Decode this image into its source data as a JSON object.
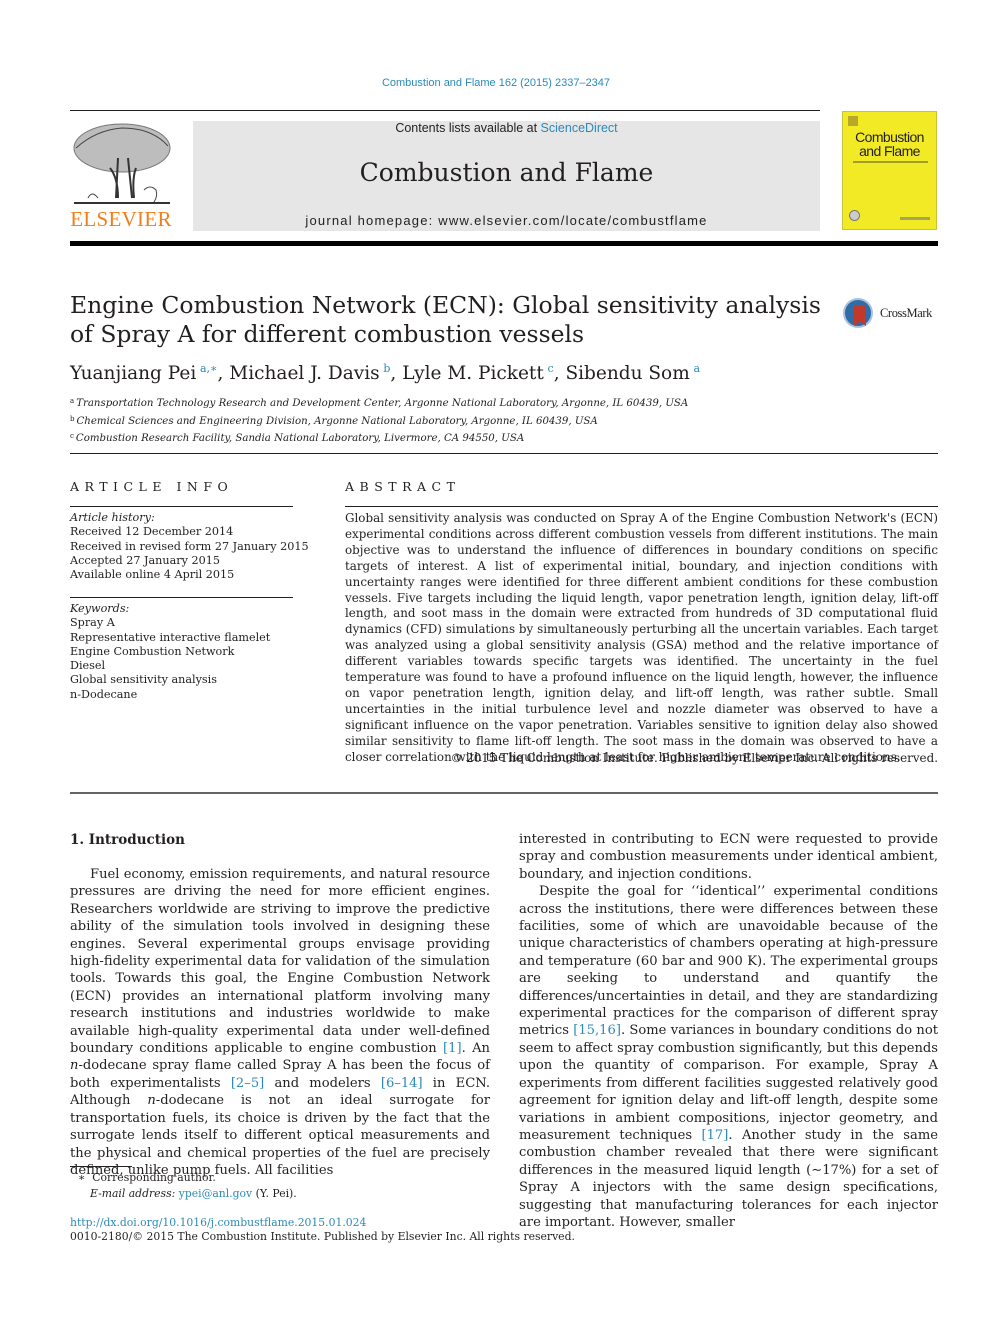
{
  "header": {
    "journal_ref": "Combustion and Flame 162 (2015) 2337–2347",
    "contents_prefix": "Contents lists available at ",
    "contents_link": "ScienceDirect",
    "journal_name": "Combustion and Flame",
    "homepage": "journal homepage: www.elsevier.com/locate/combustflame",
    "publisher_logo_text": "ELSEVIER",
    "cover_title_line1": "Combustion",
    "cover_title_line2": "and Flame",
    "crossmark_label": "CrossMark",
    "colors": {
      "link": "#2b8ab8",
      "elsevier_orange": "#f27e1b",
      "cover_yellow": "#f1ea25",
      "banner_gray": "#e6e6e6"
    }
  },
  "article": {
    "title": "Engine Combustion Network (ECN): Global sensitivity analysis of Spray A for different combustion vessels",
    "authors": [
      {
        "name": "Yuanjiang Pei",
        "sup": "a,∗"
      },
      {
        "name": "Michael J. Davis",
        "sup": "b"
      },
      {
        "name": "Lyle M. Pickett",
        "sup": "c"
      },
      {
        "name": "Sibendu Som",
        "sup": "a"
      }
    ],
    "affiliations": [
      {
        "key": "a",
        "text": "Transportation Technology Research and Development Center, Argonne National Laboratory, Argonne, IL 60439, USA"
      },
      {
        "key": "b",
        "text": "Chemical Sciences and Engineering Division, Argonne National Laboratory, Argonne, IL 60439, USA"
      },
      {
        "key": "c",
        "text": "Combustion Research Facility, Sandia National Laboratory, Livermore, CA 94550, USA"
      }
    ]
  },
  "article_info": {
    "label": "ARTICLE INFO",
    "history_label": "Article history:",
    "history": [
      "Received 12 December 2014",
      "Received in revised form 27 January 2015",
      "Accepted 27 January 2015",
      "Available online 4 April 2015"
    ],
    "keywords_label": "Keywords:",
    "keywords": [
      "Spray A",
      "Representative interactive flamelet",
      "Engine Combustion Network",
      "Diesel",
      "Global sensitivity analysis",
      "n-Dodecane"
    ]
  },
  "abstract": {
    "label": "ABSTRACT",
    "text": "Global sensitivity analysis was conducted on Spray A of the Engine Combustion Network's (ECN) experimental conditions across different combustion vessels from different institutions. The main objective was to understand the influence of differences in boundary conditions on specific targets of interest. A list of experimental initial, boundary, and injection conditions with uncertainty ranges were identified for three different ambient conditions for these combustion vessels. Five targets including the liquid length, vapor penetration length, ignition delay, lift-off length, and soot mass in the domain were extracted from hundreds of 3D computational fluid dynamics (CFD) simulations by simultaneously perturbing all the uncertain variables. Each target was analyzed using a global sensitivity analysis (GSA) method and the relative importance of different variables towards specific targets was identified. The uncertainty in the fuel temperature was found to have a profound influence on the liquid length, however, the influence on vapor penetration length, ignition delay, and lift-off length, was rather subtle. Small uncertainties in the initial turbulence level and nozzle diameter was observed to have a significant influence on the vapor penetration. Variables sensitive to ignition delay also showed similar sensitivity to flame lift-off length. The soot mass in the domain was observed to have a closer correlation with the liquid length at least for higher ambient temperature conditions.",
    "copyright": "© 2015 The Combustion Institute. Published by Elsevier Inc. All rights reserved."
  },
  "body": {
    "section_heading": "1. Introduction",
    "left_column": {
      "p1_a": "Fuel economy, emission requirements, and natural resource pressures are driving the need for more efficient engines. Researchers worldwide are striving to improve the predictive ability of the simulation tools involved in designing these engines. Several experimental groups envisage providing high-fidelity experimental data for validation of the simulation tools. Towards this goal, the Engine Combustion Network (ECN) provides an international platform involving many research institutions and industries worldwide to make available high-quality experimental data under well-defined boundary conditions applicable to engine combustion ",
      "ref1": "[1]",
      "p1_b": ". An ",
      "p1_ital": "n",
      "p1_c": "-dodecane spray flame called Spray A has been the focus of both experimentalists ",
      "ref2": "[2–5]",
      "p1_d": " and modelers ",
      "ref3": "[6–14]",
      "p1_e": " in ECN. Although ",
      "p1_ital2": "n",
      "p1_f": "-dodecane is not an ideal surrogate for transportation fuels, its choice is driven by the fact that the surrogate lends itself to different optical measurements and the physical and chemical properties of the fuel are precisely defined, unlike pump fuels. All facilities"
    },
    "right_column": {
      "p1_cont": "interested in contributing to ECN were requested to provide spray and combustion measurements under identical ambient, boundary, and injection conditions.",
      "p2_a": "Despite the goal for ‘‘identical’’ experimental conditions across the institutions, there were differences between these facilities, some of which are unavoidable because of the unique characteristics of chambers operating at high-pressure and temperature (60 bar and 900 K). The experimental groups are seeking to understand and quantify the differences/uncertainties in detail, and they are standardizing experimental practices for the comparison of different spray metrics ",
      "ref4": "[15,16]",
      "p2_b": ". Some variances in boundary conditions do not seem to affect spray combustion significantly, but this depends upon the quantity of comparison. For example, Spray A experiments from different facilities suggested relatively good agreement for ignition delay and lift-off length, despite some variations in ambient compositions, injector geometry, and measurement techniques ",
      "ref5": "[17]",
      "p2_c": ". Another study in the same combustion chamber revealed that there were significant differences in the measured liquid length (∼17%) for a set of Spray A injectors with the same design specifications, suggesting that manufacturing tolerances for each injector are important. However, smaller"
    }
  },
  "footer": {
    "footnote_mark": "∗",
    "footnote_text": "Corresponding author.",
    "email_label": "E-mail address: ",
    "email": "ypei@anl.gov",
    "email_suffix": " (Y. Pei).",
    "doi": "http://dx.doi.org/10.1016/j.combustflame.2015.01.024",
    "issn_line": "0010-2180/© 2015 The Combustion Institute. Published by Elsevier Inc. All rights reserved."
  }
}
